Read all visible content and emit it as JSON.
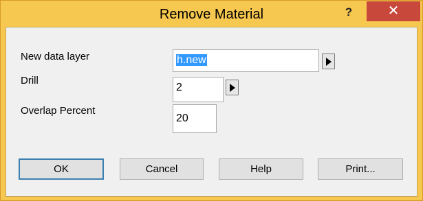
{
  "window": {
    "title": "Remove Material",
    "help_label": "?",
    "close_label": "✕"
  },
  "form": {
    "new_data_layer": {
      "label": "New data layer",
      "value": "h.new"
    },
    "drill": {
      "label": "Drill",
      "value": "2"
    },
    "overlap_percent": {
      "label": "Overlap Percent",
      "value": "20"
    }
  },
  "buttons": {
    "ok": "OK",
    "cancel": "Cancel",
    "help": "Help",
    "print": "Print..."
  },
  "colors": {
    "titlebar": "#f7c84f",
    "close": "#c9483c",
    "selection": "#3399ff"
  }
}
